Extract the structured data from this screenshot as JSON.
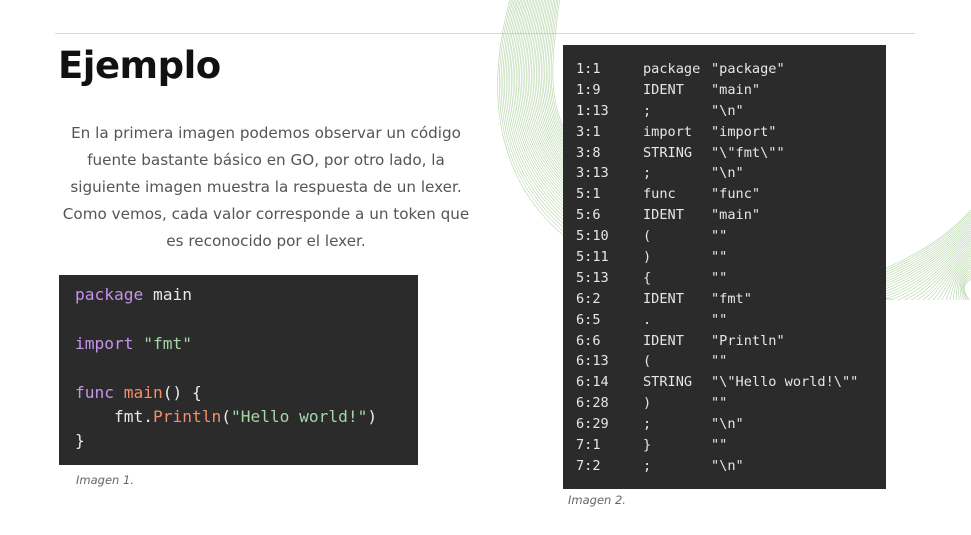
{
  "slide": {
    "title": "Ejemplo",
    "description_lines": [
      "En la primera imagen podemos observar un código",
      "fuente bastante básico en GO, por otro lado, la",
      "siguiente imagen muestra la respuesta de un lexer.",
      "Como vemos, cada valor corresponde a un token que",
      "es reconocido por el lexer."
    ],
    "caption1": "Imagen 1.",
    "caption2": "Imagen 2."
  },
  "code_sample": {
    "l1_kw": "package",
    "l1_rest": " main",
    "l3_kw": "import",
    "l3_sp": " ",
    "l3_str": "\"fmt\"",
    "l5_kw": "func",
    "l5_sp": " ",
    "l5_fn": "main",
    "l5_rest": "() {",
    "l6_pre": "    fmt.",
    "l6_fn": "Println",
    "l6_open": "(",
    "l6_str": "\"Hello world!\"",
    "l6_close": ")",
    "l7": "}"
  },
  "tokens": [
    {
      "pos": "1:1",
      "tok": "package",
      "lit": "\"package\""
    },
    {
      "pos": "1:9",
      "tok": "IDENT",
      "lit": "\"main\""
    },
    {
      "pos": "1:13",
      "tok": ";",
      "lit": "\"\\n\""
    },
    {
      "pos": "3:1",
      "tok": "import",
      "lit": "\"import\""
    },
    {
      "pos": "3:8",
      "tok": "STRING",
      "lit": "\"\\\"fmt\\\"\""
    },
    {
      "pos": "3:13",
      "tok": ";",
      "lit": "\"\\n\""
    },
    {
      "pos": "5:1",
      "tok": "func",
      "lit": "\"func\""
    },
    {
      "pos": "5:6",
      "tok": "IDENT",
      "lit": "\"main\""
    },
    {
      "pos": "5:10",
      "tok": "(",
      "lit": "\"\""
    },
    {
      "pos": "5:11",
      "tok": ")",
      "lit": "\"\""
    },
    {
      "pos": "5:13",
      "tok": "{",
      "lit": "\"\""
    },
    {
      "pos": "6:2",
      "tok": "IDENT",
      "lit": "\"fmt\""
    },
    {
      "pos": "6:5",
      "tok": ".",
      "lit": "\"\""
    },
    {
      "pos": "6:6",
      "tok": "IDENT",
      "lit": "\"Println\""
    },
    {
      "pos": "6:13",
      "tok": "(",
      "lit": "\"\""
    },
    {
      "pos": "6:14",
      "tok": "STRING",
      "lit": "\"\\\"Hello world!\\\"\""
    },
    {
      "pos": "6:28",
      "tok": ")",
      "lit": "\"\""
    },
    {
      "pos": "6:29",
      "tok": ";",
      "lit": "\"\\n\""
    },
    {
      "pos": "7:1",
      "tok": "}",
      "lit": "\"\""
    },
    {
      "pos": "7:2",
      "tok": ";",
      "lit": "\"\\n\""
    }
  ],
  "colors": {
    "code_bg": "#2b2b2b",
    "keyword": "#c792ea",
    "function": "#f78c6c",
    "string": "#a5d6a7",
    "decoration": "#8fbf7a"
  }
}
